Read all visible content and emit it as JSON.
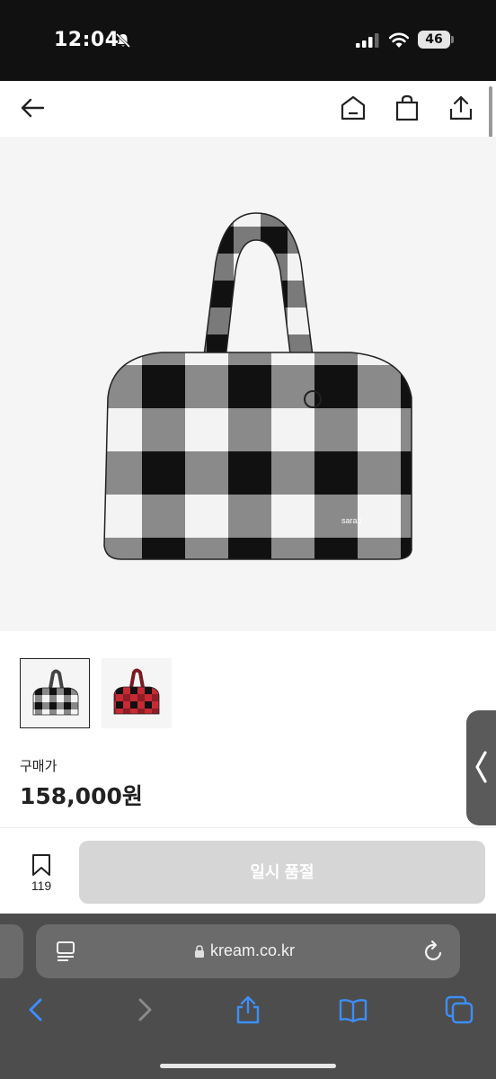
{
  "status_bar": {
    "time": "12:04",
    "battery": "46",
    "icons": [
      "bell-slash-icon",
      "signal-icon",
      "wifi-icon",
      "battery-icon"
    ]
  },
  "top_nav": {
    "icons": [
      "back-arrow-icon",
      "home-icon",
      "shopping-bag-icon",
      "share-icon"
    ]
  },
  "product": {
    "image_count": 2,
    "carousel_progress": 0.34,
    "thumbnail_colors": [
      "#111111",
      "#c62a34"
    ],
    "price_label": "구매가",
    "price": "158,000원"
  },
  "bottom_bar": {
    "wish_count": "119",
    "button_label": "일시 품절"
  },
  "browser": {
    "url": "kream.co.kr",
    "icons": [
      "reader-mode-icon",
      "lock-icon",
      "reload-icon",
      "back-chevron-icon",
      "forward-chevron-icon",
      "share-icon",
      "bookmarks-icon",
      "tabs-icon"
    ]
  },
  "colors": {
    "accent_text": "#222222",
    "button_disabled": "#d6d6d6",
    "safari_blue": "#3d8ef7",
    "status_bar": "#111111"
  }
}
